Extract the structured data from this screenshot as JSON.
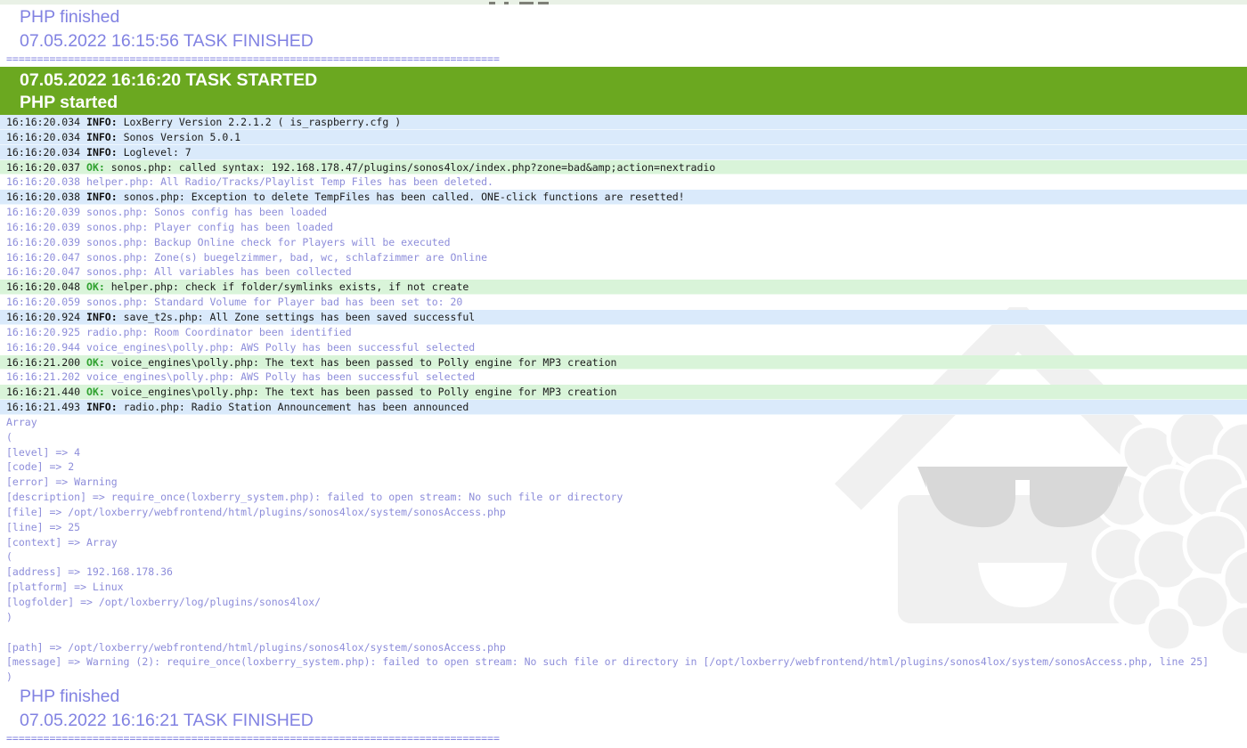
{
  "colors": {
    "banner_green": "#6ba820",
    "info_row_bg": "#daeafb",
    "ok_row_bg": "#d9f4d9",
    "ok_label_green": "#2ea12e",
    "verbose_purple": "#8d8dda",
    "heading_purple": "#8182e2",
    "separator_purple": "#8486e0",
    "watermark_gray": "#f0f0f0",
    "sunglasses_gray": "#d8d8d8"
  },
  "icons": {
    "watermark_icon": "loxberry-house-smiley-raspberry"
  },
  "previous_task": {
    "php_finished": "PHP finished",
    "task_finished": "07.05.2022 16:15:56 TASK FINISHED"
  },
  "separator": "================================================================================",
  "task_banner": {
    "task_started": "07.05.2022 16:16:20 TASK STARTED",
    "php_started": "PHP started"
  },
  "log_lines": [
    {
      "type": "info",
      "time": "16:16:20.034",
      "label": "INFO:",
      "text": "LoxBerry Version 2.2.1.2 ( is_raspberry.cfg )"
    },
    {
      "type": "info",
      "time": "16:16:20.034",
      "label": "INFO:",
      "text": "Sonos Version 5.0.1"
    },
    {
      "type": "info",
      "time": "16:16:20.034",
      "label": "INFO:",
      "text": "Loglevel: 7"
    },
    {
      "type": "ok",
      "time": "16:16:20.037",
      "label": "OK:",
      "text": "sonos.php: called syntax: 192.168.178.47/plugins/sonos4lox/index.php?zone=bad&amp;action=nextradio"
    },
    {
      "type": "verbose",
      "time": "16:16:20.038",
      "label": "",
      "text": "helper.php: All Radio/Tracks/Playlist Temp Files has been deleted."
    },
    {
      "type": "info",
      "time": "16:16:20.038",
      "label": "INFO:",
      "text": "sonos.php: Exception to delete TempFiles has been called. ONE-click functions are resetted!"
    },
    {
      "type": "verbose",
      "time": "16:16:20.039",
      "label": "",
      "text": "sonos.php: Sonos config has been loaded"
    },
    {
      "type": "verbose",
      "time": "16:16:20.039",
      "label": "",
      "text": "sonos.php: Player config has been loaded"
    },
    {
      "type": "verbose",
      "time": "16:16:20.039",
      "label": "",
      "text": "sonos.php: Backup Online check for Players will be executed"
    },
    {
      "type": "verbose",
      "time": "16:16:20.047",
      "label": "",
      "text": "sonos.php: Zone(s) buegelzimmer, bad, wc, schlafzimmer are Online"
    },
    {
      "type": "verbose",
      "time": "16:16:20.047",
      "label": "",
      "text": "sonos.php: All variables has been collected"
    },
    {
      "type": "ok",
      "time": "16:16:20.048",
      "label": "OK:",
      "text": "helper.php: check if folder/symlinks exists, if not create"
    },
    {
      "type": "verbose",
      "time": "16:16:20.059",
      "label": "",
      "text": "sonos.php: Standard Volume for Player bad has been set to: 20"
    },
    {
      "type": "info",
      "time": "16:16:20.924",
      "label": "INFO:",
      "text": "save_t2s.php: All Zone settings has been saved successful"
    },
    {
      "type": "verbose",
      "time": "16:16:20.925",
      "label": "",
      "text": "radio.php: Room Coordinator been identified"
    },
    {
      "type": "verbose",
      "time": "16:16:20.944",
      "label": "",
      "text": "voice_engines\\polly.php: AWS Polly has been successful selected"
    },
    {
      "type": "ok",
      "time": "16:16:21.200",
      "label": "OK:",
      "text": "voice_engines\\polly.php: The text has been passed to Polly engine for MP3 creation"
    },
    {
      "type": "verbose",
      "time": "16:16:21.202",
      "label": "",
      "text": "voice_engines\\polly.php: AWS Polly has been successful selected"
    },
    {
      "type": "ok",
      "time": "16:16:21.440",
      "label": "OK:",
      "text": "voice_engines\\polly.php: The text has been passed to Polly engine for MP3 creation"
    },
    {
      "type": "info",
      "time": "16:16:21.493",
      "label": "INFO:",
      "text": "radio.php: Radio Station Announcement has been announced"
    }
  ],
  "array_dump": [
    "Array",
    "(",
    "[level] => 4",
    "[code] => 2",
    "[error] => Warning",
    "[description] => require_once(loxberry_system.php): failed to open stream: No such file or directory",
    "[file] => /opt/loxberry/webfrontend/html/plugins/sonos4lox/system/sonosAccess.php",
    "[line] => 25",
    "[context] => Array",
    "(",
    "[address] => 192.168.178.36",
    "[platform] => Linux",
    "[logfolder] => /opt/loxberry/log/plugins/sonos4lox/",
    ")",
    "",
    "[path] => /opt/loxberry/webfrontend/html/plugins/sonos4lox/system/sonosAccess.php",
    "[message] => Warning (2): require_once(loxberry_system.php): failed to open stream: No such file or directory in [/opt/loxberry/webfrontend/html/plugins/sonos4lox/system/sonosAccess.php, line 25]",
    ")"
  ],
  "current_task_end": {
    "php_finished": "PHP finished",
    "task_finished": "07.05.2022 16:16:21 TASK FINISHED"
  }
}
